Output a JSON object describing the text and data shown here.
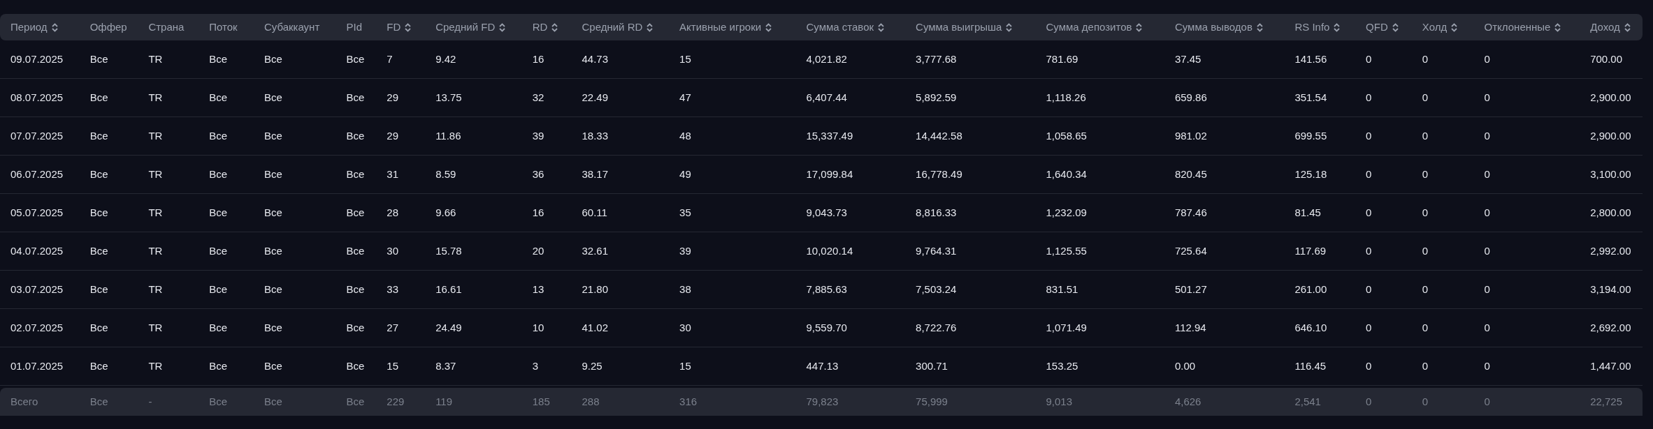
{
  "table": {
    "columns": [
      {
        "label": "Период",
        "sortable": true
      },
      {
        "label": "Оффер",
        "sortable": false
      },
      {
        "label": "Страна",
        "sortable": false
      },
      {
        "label": "Поток",
        "sortable": false
      },
      {
        "label": "Субаккаунт",
        "sortable": false
      },
      {
        "label": "PId",
        "sortable": false
      },
      {
        "label": "FD",
        "sortable": true
      },
      {
        "label": "Средний FD",
        "sortable": true
      },
      {
        "label": "RD",
        "sortable": true
      },
      {
        "label": "Средний RD",
        "sortable": true
      },
      {
        "label": "Активные игроки",
        "sortable": true
      },
      {
        "label": "Сумма ставок",
        "sortable": true
      },
      {
        "label": "Сумма выигрыша",
        "sortable": true
      },
      {
        "label": "Сумма депозитов",
        "sortable": true
      },
      {
        "label": "Сумма выводов",
        "sortable": true
      },
      {
        "label": "RS Info",
        "sortable": true
      },
      {
        "label": "QFD",
        "sortable": true
      },
      {
        "label": "Холд",
        "sortable": true
      },
      {
        "label": "Отклоненные",
        "sortable": true
      },
      {
        "label": "Доход",
        "sortable": true
      }
    ],
    "rows": [
      [
        "09.07.2025",
        "Все",
        "TR",
        "Все",
        "Все",
        "Все",
        "7",
        "9.42",
        "16",
        "44.73",
        "15",
        "4,021.82",
        "3,777.68",
        "781.69",
        "37.45",
        "141.56",
        "0",
        "0",
        "0",
        "700.00"
      ],
      [
        "08.07.2025",
        "Все",
        "TR",
        "Все",
        "Все",
        "Все",
        "29",
        "13.75",
        "32",
        "22.49",
        "47",
        "6,407.44",
        "5,892.59",
        "1,118.26",
        "659.86",
        "351.54",
        "0",
        "0",
        "0",
        "2,900.00"
      ],
      [
        "07.07.2025",
        "Все",
        "TR",
        "Все",
        "Все",
        "Все",
        "29",
        "11.86",
        "39",
        "18.33",
        "48",
        "15,337.49",
        "14,442.58",
        "1,058.65",
        "981.02",
        "699.55",
        "0",
        "0",
        "0",
        "2,900.00"
      ],
      [
        "06.07.2025",
        "Все",
        "TR",
        "Все",
        "Все",
        "Все",
        "31",
        "8.59",
        "36",
        "38.17",
        "49",
        "17,099.84",
        "16,778.49",
        "1,640.34",
        "820.45",
        "125.18",
        "0",
        "0",
        "0",
        "3,100.00"
      ],
      [
        "05.07.2025",
        "Все",
        "TR",
        "Все",
        "Все",
        "Все",
        "28",
        "9.66",
        "16",
        "60.11",
        "35",
        "9,043.73",
        "8,816.33",
        "1,232.09",
        "787.46",
        "81.45",
        "0",
        "0",
        "0",
        "2,800.00"
      ],
      [
        "04.07.2025",
        "Все",
        "TR",
        "Все",
        "Все",
        "Все",
        "30",
        "15.78",
        "20",
        "32.61",
        "39",
        "10,020.14",
        "9,764.31",
        "1,125.55",
        "725.64",
        "117.69",
        "0",
        "0",
        "0",
        "2,992.00"
      ],
      [
        "03.07.2025",
        "Все",
        "TR",
        "Все",
        "Все",
        "Все",
        "33",
        "16.61",
        "13",
        "21.80",
        "38",
        "7,885.63",
        "7,503.24",
        "831.51",
        "501.27",
        "261.00",
        "0",
        "0",
        "0",
        "3,194.00"
      ],
      [
        "02.07.2025",
        "Все",
        "TR",
        "Все",
        "Все",
        "Все",
        "27",
        "24.49",
        "10",
        "41.02",
        "30",
        "9,559.70",
        "8,722.76",
        "1,071.49",
        "112.94",
        "646.10",
        "0",
        "0",
        "0",
        "2,692.00"
      ],
      [
        "01.07.2025",
        "Все",
        "TR",
        "Все",
        "Все",
        "Все",
        "15",
        "8.37",
        "3",
        "9.25",
        "15",
        "447.13",
        "300.71",
        "153.25",
        "0.00",
        "116.45",
        "0",
        "0",
        "0",
        "1,447.00"
      ]
    ],
    "totals": [
      "Всего",
      "Все",
      "-",
      "Все",
      "Все",
      "Все",
      "229",
      "119",
      "185",
      "288",
      "316",
      "79,823",
      "75,999",
      "9,013",
      "4,626",
      "2,541",
      "0",
      "0",
      "0",
      "22,725"
    ]
  }
}
